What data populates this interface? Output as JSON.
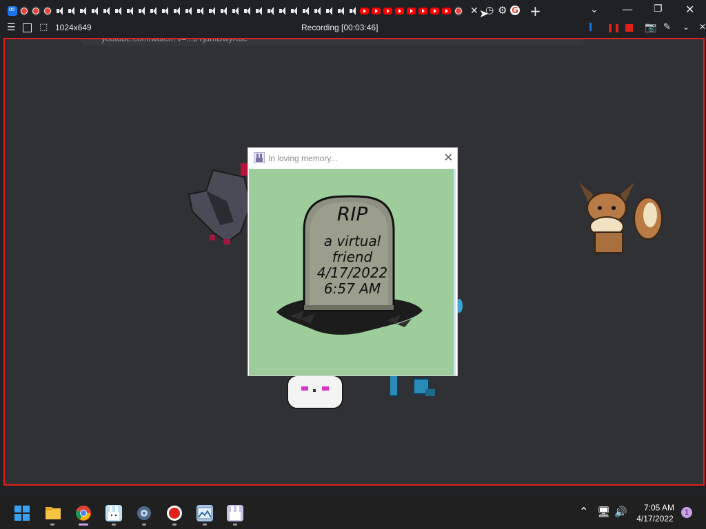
{
  "recorder": {
    "title": "Recording [00:03:46]",
    "size_label": "1024x649"
  },
  "browser": {
    "address_partial": "youtube.com/watch?v=...bYjamDwyKbc"
  },
  "popup": {
    "title": "In loving memory...",
    "close_label": "✕",
    "epitaph": {
      "heading": "RIP",
      "line1": "a virtual",
      "line2": "friend",
      "date": "4/17/2022",
      "time": "6:57 AM"
    }
  },
  "taskbar": {
    "time": "7:05 AM",
    "date": "4/17/2022",
    "notification_count": "1",
    "apps": [
      "start-icon",
      "file-explorer-icon",
      "chrome-icon",
      "bunny-app-icon",
      "settings-icon",
      "recorder-icon",
      "photos-icon",
      "bunny-app-2-icon"
    ]
  },
  "colors": {
    "recording_frame": "#e0201a",
    "popup_background": "#9dcd9b",
    "accent": "#1a73e8"
  }
}
